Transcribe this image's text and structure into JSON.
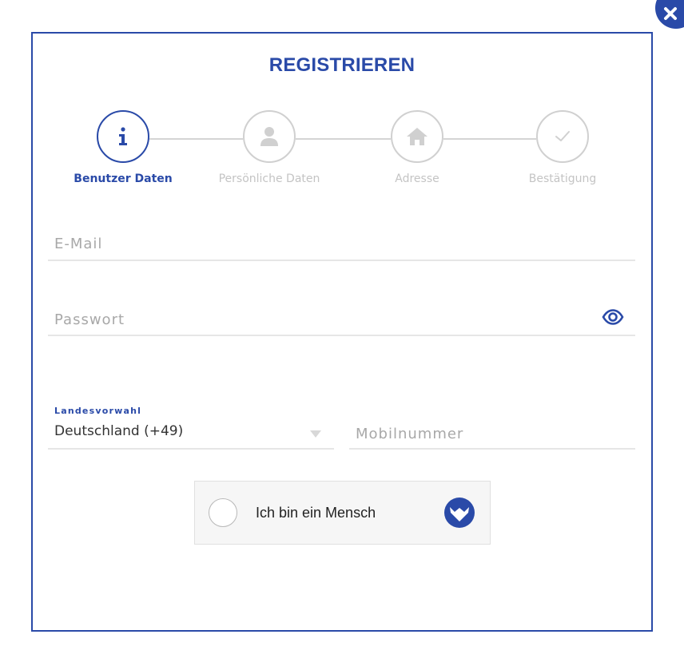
{
  "dialog": {
    "title": "REGISTRIEREN",
    "accent_color": "#2a4aa8",
    "close_icon": "close-icon"
  },
  "stepper": {
    "steps": [
      {
        "label": "Benutzer Daten",
        "icon": "info-icon",
        "active": true
      },
      {
        "label": "Persönliche Daten",
        "icon": "person-icon",
        "active": false
      },
      {
        "label": "Adresse",
        "icon": "home-icon",
        "active": false
      },
      {
        "label": "Bestätigung",
        "icon": "check-icon",
        "active": false
      }
    ]
  },
  "form": {
    "email": {
      "placeholder": "E-Mail",
      "value": ""
    },
    "password": {
      "placeholder": "Passwort",
      "value": "",
      "toggle_icon": "eye-icon"
    },
    "country_code": {
      "label": "Landesvorwahl",
      "value": "Deutschland (+49)"
    },
    "mobile": {
      "placeholder": "Mobilnummer",
      "value": ""
    }
  },
  "captcha": {
    "label": "Ich bin ein Mensch",
    "checked": false,
    "logo_icon": "fox-shield-icon"
  }
}
